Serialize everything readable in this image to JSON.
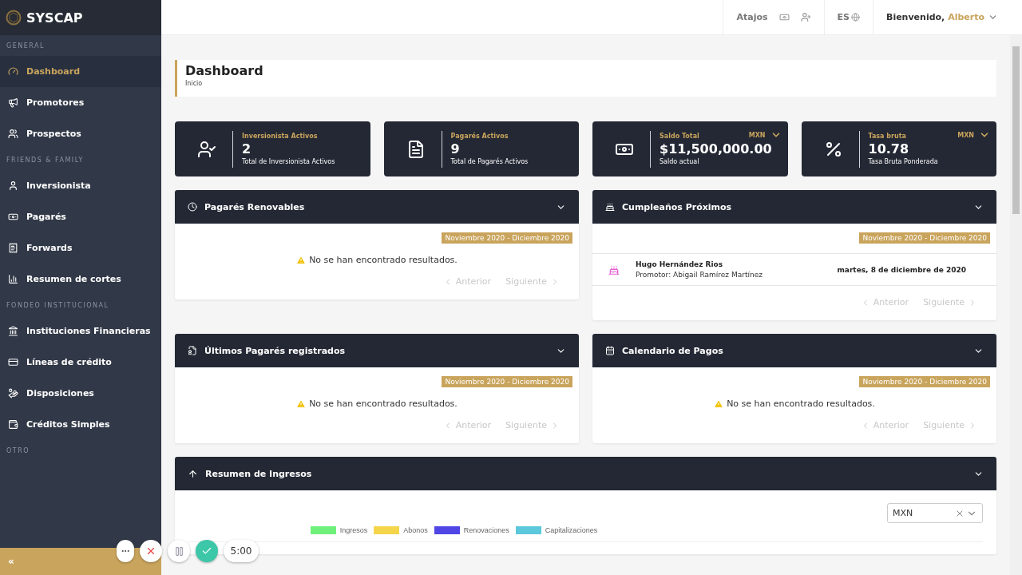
{
  "brand": {
    "name": "SYSCAP"
  },
  "sidebar": {
    "sections": [
      {
        "title": "GENERAL",
        "items": [
          {
            "label": "Dashboard",
            "selected": true
          },
          {
            "label": "Promotores",
            "selected": false
          },
          {
            "label": "Prospectos",
            "selected": false
          }
        ]
      },
      {
        "title": "FRIENDS & FAMILY",
        "items": [
          {
            "label": "Inversionista",
            "selected": false
          },
          {
            "label": "Pagarés",
            "selected": false
          },
          {
            "label": "Forwards",
            "selected": false
          },
          {
            "label": "Resumen de cortes",
            "selected": false
          }
        ]
      },
      {
        "title": "FONDEO INSTITUCIONAL",
        "items": [
          {
            "label": "Instituciones Financieras",
            "selected": false
          },
          {
            "label": "Líneas de crédito",
            "selected": false
          },
          {
            "label": "Disposiciones",
            "selected": false
          },
          {
            "label": "Créditos Simples",
            "selected": false
          }
        ]
      },
      {
        "title": "OTRO"
      }
    ],
    "collapse": "«"
  },
  "topbar": {
    "shortcuts": "Atajos",
    "language": "ES",
    "greeting": "Bienvenido,",
    "user": "Alberto"
  },
  "page": {
    "title": "Dashboard",
    "breadcrumb": "Inicio"
  },
  "stats": [
    {
      "title": "Inversionista Activos",
      "value": "2",
      "subtitle": "Total de Inversionista Activos"
    },
    {
      "title": "Pagarés Activos",
      "value": "9",
      "subtitle": "Total de Pagarés Activos"
    },
    {
      "title": "Saldo Total",
      "value": "$11,500,000.00",
      "subtitle": "Saldo actual",
      "currency": "MXN"
    },
    {
      "title": "Tasa bruta",
      "value": "10.78",
      "subtitle": "Tasa Bruta Ponderada",
      "currency": "MXN"
    }
  ],
  "panels": [
    {
      "kind": "empty",
      "title": "Pagarés Renovables",
      "period": "Noviembre 2020 - Diciembre 2020",
      "message": "No se han encontrado resultados.",
      "prev": {
        "label": "Anterior",
        "disabled": true
      },
      "next": {
        "label": "Siguiente",
        "disabled": true
      }
    },
    {
      "kind": "list",
      "title": "Cumpleaños Próximos",
      "period": "Noviembre 2020 - Diciembre 2020",
      "rows": [
        {
          "name": "Hugo Hernández Rios",
          "detail": "Promotor: Abigail Ramírez Martínez",
          "date": "martes, 8 de diciembre de 2020"
        }
      ],
      "prev": {
        "label": "Anterior",
        "disabled": true
      },
      "next": {
        "label": "Siguiente",
        "disabled": true
      }
    },
    {
      "kind": "empty",
      "title": "Últimos Pagarés registrados",
      "period": "Noviembre 2020 - Diciembre 2020",
      "message": "No se han encontrado resultados.",
      "prev": {
        "label": "Anterior",
        "disabled": true
      },
      "next": {
        "label": "Siguiente",
        "disabled": true
      }
    },
    {
      "kind": "empty",
      "title": "Calendario de Pagos",
      "period": "Noviembre 2020 - Diciembre 2020",
      "message": "No se han encontrado resultados.",
      "prev": {
        "label": "Anterior",
        "disabled": true
      },
      "next": {
        "label": "Siguiente",
        "disabled": true
      }
    }
  ],
  "summary": {
    "title": "Resumen de Ingresos",
    "currency": "MXN",
    "legend": [
      {
        "label": "Ingresos",
        "color": "#6ef07a"
      },
      {
        "label": "Abonos",
        "color": "#f5d54a"
      },
      {
        "label": "Renovaciones",
        "color": "#4f46e5"
      },
      {
        "label": "Capitalizaciones",
        "color": "#5bc8dc"
      }
    ]
  },
  "recorder": {
    "time": "5:00"
  }
}
